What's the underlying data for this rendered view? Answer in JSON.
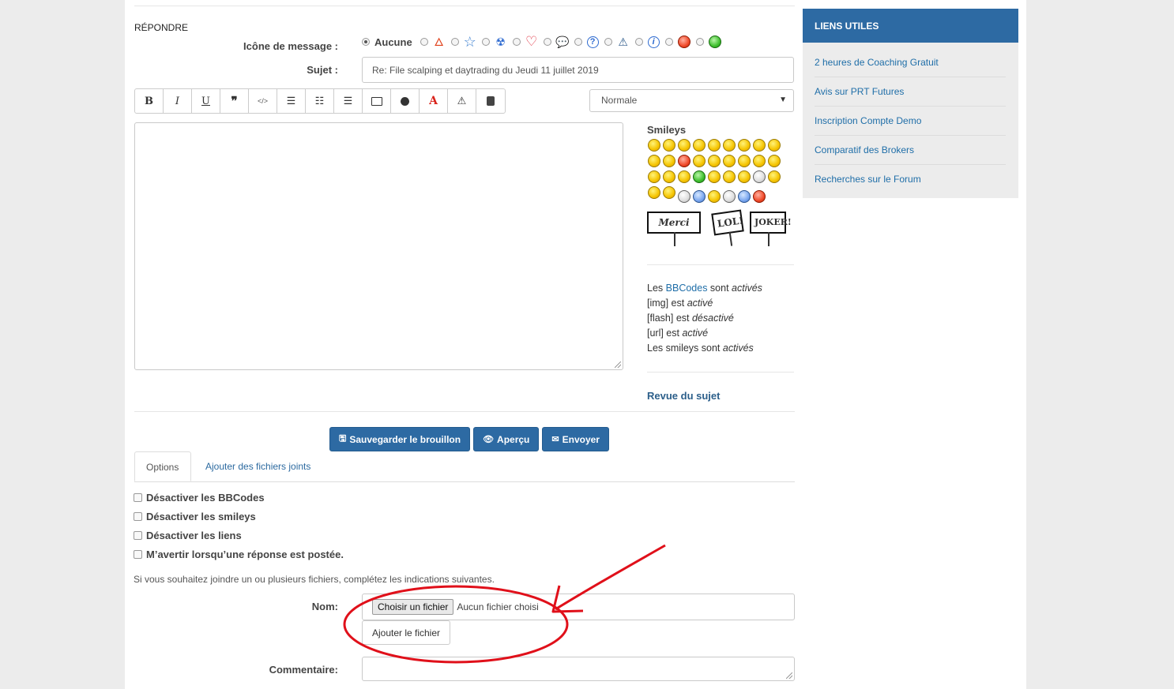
{
  "reply": {
    "title": "RÉPONDRE",
    "icon_label": "Icône de message :",
    "icon_none": "Aucune",
    "icons": [
      "fire-icon",
      "star-icon",
      "radioactive-icon",
      "heart-icon",
      "speech-bubble-icon",
      "question-icon",
      "warning-icon",
      "info-icon",
      "shocked-face-icon",
      "green-face-icon"
    ],
    "subject_label": "Sujet :",
    "subject_value": "Re: File scalping et daytrading du Jeudi 11 juillet 2019",
    "font_size_value": "Normale"
  },
  "toolbar": {
    "bold": "B",
    "italic": "I",
    "underline": "U",
    "quote": "❞",
    "code": "</>",
    "color": "A",
    "warning": "⚠"
  },
  "smileys": {
    "title": "Smileys",
    "sign_merci": "Merci",
    "sign_lol": "LOL!",
    "sign_joker": "JOKER!"
  },
  "bbcode": {
    "line1_pre": "Les ",
    "line1_link": "BBCodes",
    "line1_mid": " sont ",
    "line1_state": "activés",
    "line2_pre": "[img] est ",
    "line2_state": "activé",
    "line3_pre": "[flash] est ",
    "line3_state": "désactivé",
    "line4_pre": "[url] est ",
    "line4_state": "activé",
    "line5_pre": "Les smileys sont ",
    "line5_state": "activés"
  },
  "review_link": "Revue du sujet",
  "buttons": {
    "save": "Sauvegarder le brouillon",
    "preview": "Aperçu",
    "send": "Envoyer"
  },
  "tabs": {
    "options": "Options",
    "attachments": "Ajouter des fichiers joints"
  },
  "options": {
    "disable_bbcode": "Désactiver les BBCodes",
    "disable_smileys": "Désactiver les smileys",
    "disable_links": "Désactiver les liens",
    "notify": "M’avertir lorsqu’une réponse est postée."
  },
  "attach": {
    "note": "Si vous souhaitez joindre un ou plusieurs fichiers, complétez les indications suivantes.",
    "name_label": "Nom:",
    "choose_button": "Choisir un fichier",
    "no_file": "Aucun fichier choisi",
    "add_button": "Ajouter le fichier",
    "comment_label": "Commentaire:"
  },
  "sidebar": {
    "heading": "LIENS UTILES",
    "links": [
      "2 heures de Coaching Gratuit",
      "Avis sur PRT Futures",
      "Inscription Compte Demo",
      "Comparatif des Brokers",
      "Recherches sur le Forum"
    ]
  },
  "colors": {
    "accent": "#2d6aa3",
    "link": "#1f6ea8",
    "annotation": "#e0101a",
    "sidebar_bg": "#ececec"
  }
}
